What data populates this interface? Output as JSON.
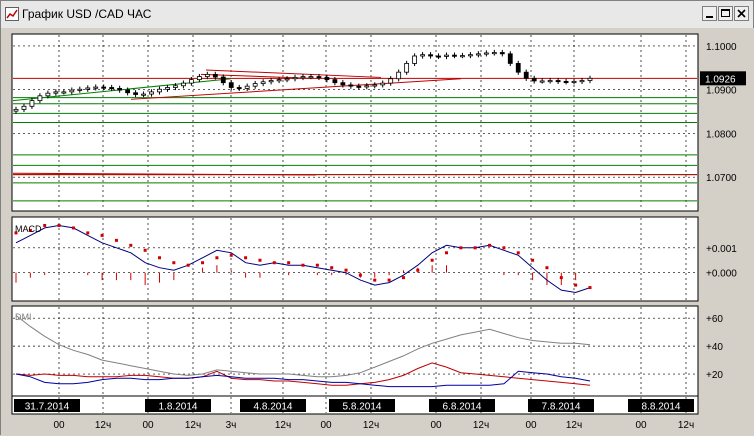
{
  "window": {
    "title": "График USD /CAD  ЧАС"
  },
  "colors": {
    "bg": "#ffffff",
    "grid": "#000000",
    "candle": "#000000",
    "support": "#008000",
    "resistance": "#c00000",
    "macd": "#000080",
    "signal": "#d00000",
    "histogram": "#d00000",
    "dmi_adx": "#808080",
    "dmi_plus": "#c00000",
    "dmi_minus": "#0000a0",
    "price_box": "#000000"
  },
  "chart_data": [
    {
      "panel": "price",
      "type": "candlestick",
      "ylim": [
        1.0625,
        1.1025
      ],
      "y_ticks": [
        {
          "value": 1.1,
          "label": "1.1000"
        },
        {
          "value": 1.09,
          "label": "1.0900"
        },
        {
          "value": 1.08,
          "label": "1.0800"
        },
        {
          "value": 1.07,
          "label": "1.0700"
        }
      ],
      "last_price": {
        "value": 1.0926,
        "label": "1.0926"
      },
      "horizontal_levels_green": [
        1.0882,
        1.0868,
        1.0846,
        1.0825,
        1.0751,
        1.0727,
        1.0706,
        1.0687,
        1.0646
      ],
      "horizontal_levels_red": [
        1.0926,
        1.0706
      ],
      "close": [
        1.0855,
        1.0862,
        1.0875,
        1.0886,
        1.0892,
        1.0895,
        1.0895,
        1.0899,
        1.0901,
        1.0904,
        1.0906,
        1.0905,
        1.0903,
        1.0899,
        1.0893,
        1.0889,
        1.089,
        1.0895,
        1.0901,
        1.0905,
        1.0909,
        1.0915,
        1.0923,
        1.093,
        1.0935,
        1.0929,
        1.0916,
        1.0905,
        1.0903,
        1.0908,
        1.0914,
        1.0918,
        1.0921,
        1.0923,
        1.0925,
        1.0928,
        1.093,
        1.093,
        1.0928,
        1.0923,
        1.0916,
        1.0911,
        1.0908,
        1.0907,
        1.0909,
        1.0911,
        1.0915,
        1.0925,
        1.094,
        1.096,
        1.0977,
        1.098,
        1.0977,
        1.0976,
        1.0979,
        1.0978,
        1.0978,
        1.098,
        1.0982,
        1.0984,
        1.0985,
        1.0982,
        1.096,
        1.094,
        1.0926,
        1.092,
        1.092,
        1.0921,
        1.0919,
        1.0918,
        1.0919,
        1.0921,
        1.0926
      ]
    },
    {
      "panel": "indicator",
      "type": "line",
      "name": "MACD",
      "ylim": [
        -0.0011,
        0.0022
      ],
      "y_ticks": [
        {
          "value": 0.001,
          "label": "+0.001"
        },
        {
          "value": 0.0,
          "label": "+0.000"
        }
      ],
      "series": [
        {
          "values": [
            0.0012,
            0.0015,
            0.0018,
            0.0019,
            0.0018,
            0.0015,
            0.0012,
            0.001,
            0.0008,
            0.0004,
            0.0002,
            0.0001,
            0.0003,
            0.0006,
            0.0009,
            0.0008,
            0.0004,
            0.0003,
            0.0004,
            0.0003,
            0.0003,
            0.0002,
            0.0001,
            0.0,
            -0.0003,
            -0.0005,
            -0.0004,
            -0.0001,
            0.0003,
            0.0008,
            0.0011,
            0.001,
            0.001,
            0.0011,
            0.0009,
            0.0007,
            0.0002,
            -0.0003,
            -0.0007,
            -0.0008,
            -0.0006
          ]
        },
        {
          "values": [
            0.0016,
            0.0017,
            0.0019,
            0.0019,
            0.0018,
            0.0016,
            0.0015,
            0.0013,
            0.0011,
            0.0009,
            0.0006,
            0.0004,
            0.0003,
            0.0004,
            0.0006,
            0.0007,
            0.0006,
            0.0005,
            0.0004,
            0.0004,
            0.0003,
            0.0003,
            0.0002,
            0.0001,
            -0.0001,
            -0.0003,
            -0.0003,
            -0.0002,
            0.0001,
            0.0005,
            0.0008,
            0.001,
            0.001,
            0.0011,
            0.001,
            0.0008,
            0.0005,
            0.0002,
            -0.0002,
            -0.0005,
            -0.0006
          ]
        }
      ]
    },
    {
      "panel": "indicator",
      "type": "line",
      "name": "DMI",
      "ylim": [
        5,
        68
      ],
      "y_ticks": [
        {
          "value": 60,
          "label": "+60"
        },
        {
          "value": 40,
          "label": "+40"
        },
        {
          "value": 20,
          "label": "+20"
        }
      ],
      "series": [
        {
          "values": [
            62,
            54,
            47,
            41,
            37,
            34,
            30,
            28,
            26,
            24,
            22,
            20,
            19,
            20,
            23,
            22,
            21,
            20,
            20,
            20,
            19,
            18,
            18,
            19,
            21,
            25,
            29,
            33,
            38,
            42,
            45,
            48,
            50,
            52,
            49,
            46,
            44,
            43,
            42,
            42,
            41
          ]
        },
        {
          "values": [
            20,
            19,
            20,
            19,
            19,
            18,
            18,
            18,
            19,
            19,
            18,
            17,
            17,
            18,
            22,
            17,
            16,
            16,
            15,
            15,
            14,
            13,
            12,
            12,
            13,
            14,
            16,
            19,
            24,
            28,
            25,
            21,
            20,
            19,
            18,
            17,
            16,
            15,
            14,
            13,
            12
          ]
        },
        {
          "values": [
            20,
            18,
            14,
            13,
            13,
            14,
            16,
            17,
            17,
            16,
            16,
            17,
            17,
            18,
            19,
            18,
            17,
            17,
            17,
            16,
            16,
            15,
            14,
            14,
            13,
            12,
            11,
            11,
            11,
            11,
            12,
            12,
            12,
            12,
            13,
            22,
            21,
            20,
            18,
            17,
            15
          ]
        }
      ]
    }
  ],
  "x_axis": {
    "date_labels": [
      "31.7.2014",
      "1.8.2014",
      "4.8.2014",
      "5.8.2014",
      "6.8.2014",
      "7.8.2014",
      "8.8.2014"
    ],
    "hour_labels": [
      "00",
      "12ч",
      "00",
      "12ч",
      "3ч",
      "12ч",
      "00",
      "12ч",
      "00",
      "12ч",
      "00",
      "12ч",
      "00",
      "12ч"
    ]
  }
}
